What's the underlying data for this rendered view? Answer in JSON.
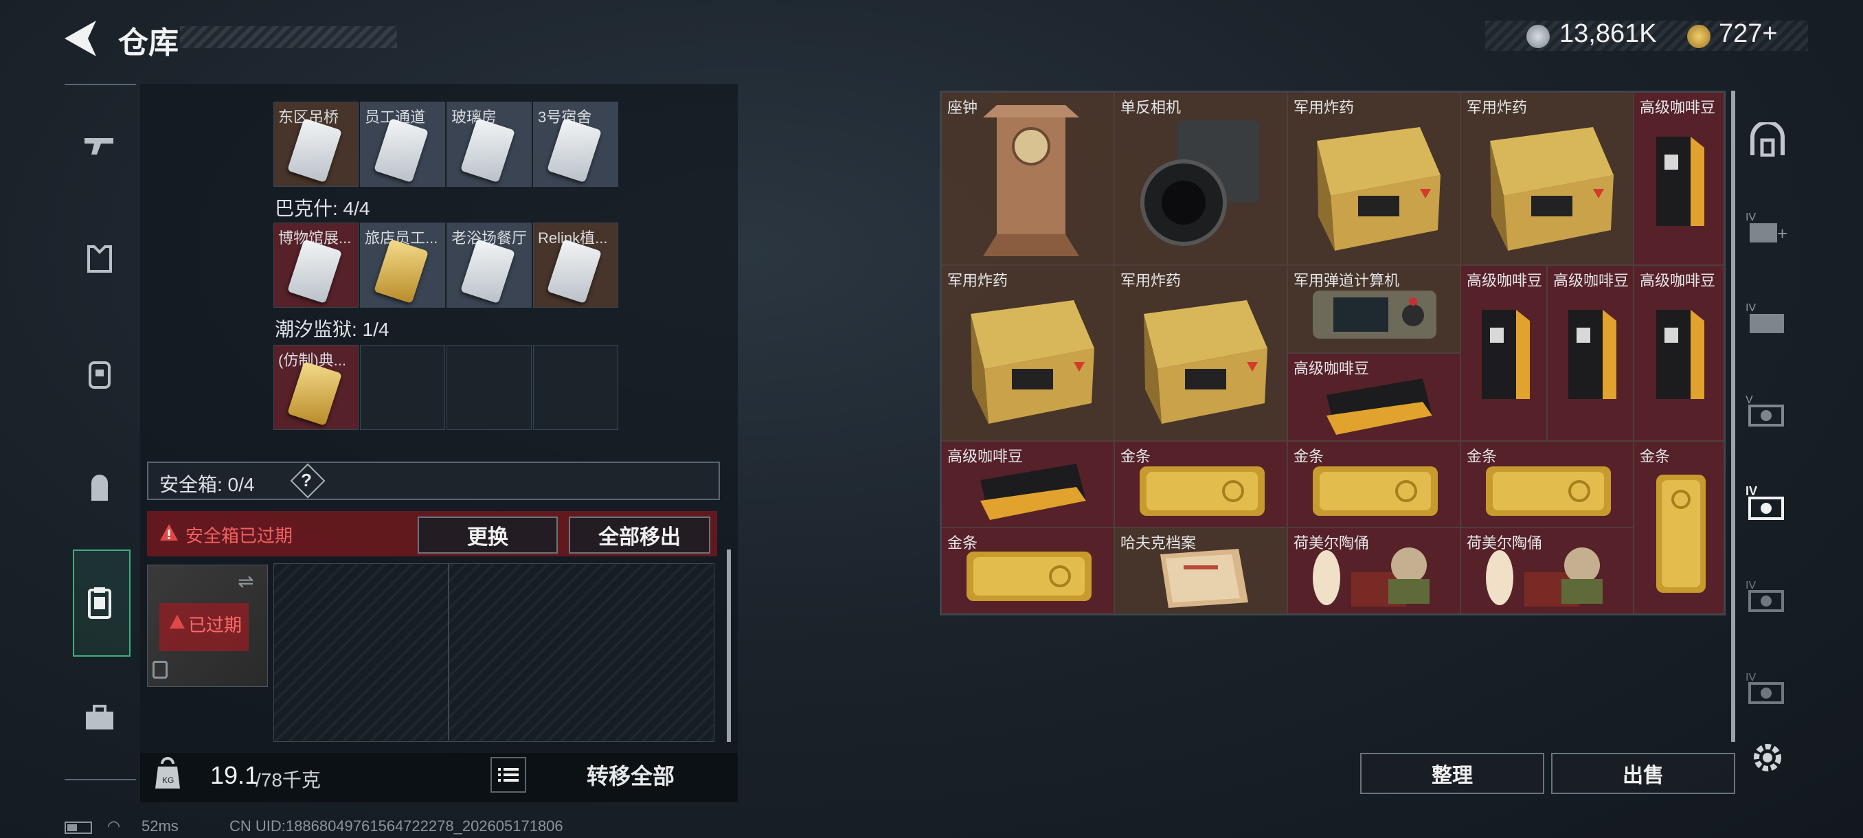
{
  "header": {
    "title": "仓库"
  },
  "currency": {
    "silver": "13,861K",
    "gold": "727+"
  },
  "key_groups": [
    {
      "label": "",
      "slots": [
        "东区吊桥",
        "员工通道",
        "玻璃房",
        "3号宿舍"
      ]
    },
    {
      "label": "巴克什: 4/4",
      "slots": [
        "博物馆展...",
        "旅店员工...",
        "老浴场餐厅",
        "Relink植..."
      ]
    },
    {
      "label": "潮汐监狱: 1/4",
      "slots": [
        "(仿制)典...",
        "",
        "",
        ""
      ]
    }
  ],
  "safebox": {
    "label": "安全箱: 0/4",
    "help": "?",
    "expired_msg": "安全箱已过期",
    "replace": "更换",
    "move_all_out": "全部移出",
    "slot_tag": "已过期"
  },
  "weight": {
    "current": "19.1",
    "max": "/78千克"
  },
  "transfer_all": "转移全部",
  "status": {
    "ping": "52ms",
    "uid": "CN UID:18868049761564722278_202605171806"
  },
  "inventory": [
    {
      "name": "座钟"
    },
    {
      "name": "单反相机"
    },
    {
      "name": "军用炸药"
    },
    {
      "name": "军用炸药"
    },
    {
      "name": "高级咖啡豆"
    },
    {
      "name": "军用炸药"
    },
    {
      "name": "军用炸药"
    },
    {
      "name": "军用弹道计算机"
    },
    {
      "name": "高级咖啡豆"
    },
    {
      "name": "高级咖啡豆"
    },
    {
      "name": "高级咖啡豆"
    },
    {
      "name": "高级咖啡豆"
    },
    {
      "name": "高级咖啡豆"
    },
    {
      "name": "金条"
    },
    {
      "name": "金条"
    },
    {
      "name": "金条"
    },
    {
      "name": "金条"
    },
    {
      "name": "金条"
    },
    {
      "name": "哈夫克档案"
    },
    {
      "name": "荷美尔陶俑"
    },
    {
      "name": "荷美尔陶俑"
    }
  ],
  "actions": {
    "sort": "整理",
    "sell": "出售"
  },
  "colors": {
    "accent": "#3fae7c",
    "rare_red": "#62222a",
    "rare_brown": "#50382c",
    "warn": "#e04848"
  }
}
